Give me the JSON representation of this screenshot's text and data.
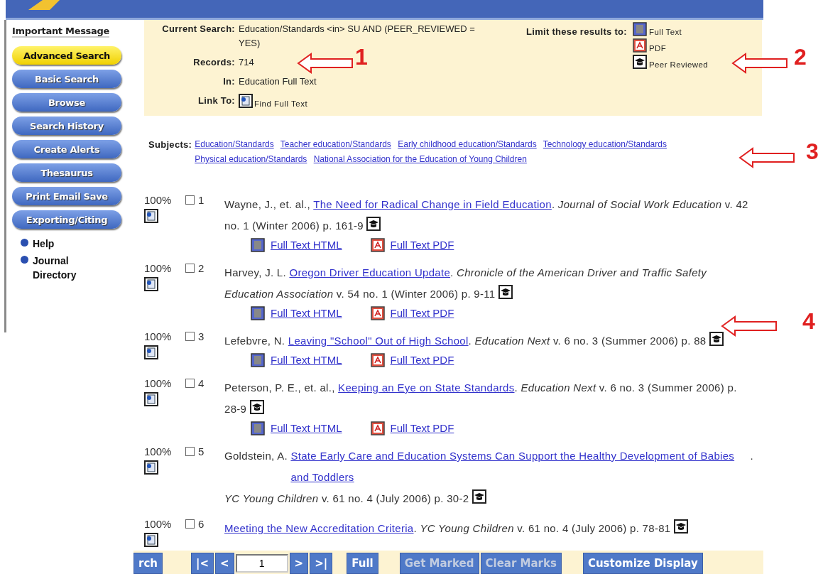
{
  "sidebar": {
    "message": "Important Message",
    "buttons": [
      {
        "label": "Advanced Search",
        "selected": true
      },
      {
        "label": "Basic Search",
        "selected": false
      },
      {
        "label": "Browse",
        "selected": false
      },
      {
        "label": "Search History",
        "selected": false
      },
      {
        "label": "Create Alerts",
        "selected": false
      },
      {
        "label": "Thesaurus",
        "selected": false
      },
      {
        "label": "Print Email Save",
        "selected": false
      },
      {
        "label": "Exporting/Citing",
        "selected": false
      }
    ],
    "links": [
      "Help",
      "Journal Directory"
    ]
  },
  "search_summary": {
    "fields": [
      {
        "kind": "text",
        "label": "Current Search:",
        "value": "Education/Standards <in> SU AND (PEER_REVIEWED = YES)"
      },
      {
        "kind": "text",
        "label": "Records:",
        "value": "714"
      },
      {
        "kind": "text",
        "label": "In:",
        "value": "Education Full Text"
      },
      {
        "kind": "link",
        "label": "Link To:",
        "value": "Find Full Text"
      }
    ],
    "limit": {
      "label": "Limit these results to:",
      "options": [
        {
          "kind": "fulltext",
          "label": "Full Text"
        },
        {
          "kind": "pdf",
          "label": "PDF"
        },
        {
          "kind": "peer",
          "label": "Peer Reviewed"
        }
      ]
    }
  },
  "subjects": {
    "label": "Subjects:",
    "items": [
      "Education/Standards",
      "Teacher education/Standards",
      "Early childhood education/Standards",
      "Technology education/Standards",
      "Physical education/Standards",
      "National Association for the Education of Young Children"
    ]
  },
  "results": [
    {
      "score": "100%",
      "checked": false,
      "number": "1",
      "lead": "Wayne, J., et. al.,",
      "title": "The Need for Radical Change in Field Education",
      "rest": ". *Journal of Social Work Education* v. 42 no. 1 (Winter 2006) p. 161-9",
      "peer_reviewed": true,
      "links": [
        {
          "kind": "html",
          "label": "Full Text HTML"
        },
        {
          "kind": "pdf",
          "label": "Full Text PDF"
        }
      ]
    },
    {
      "score": "100%",
      "checked": false,
      "number": "2",
      "lead": "Harvey, J. L.",
      "title": "Oregon Driver Education Update",
      "rest": ". *Chronicle of the American Driver and Traffic Safety Education Association* v. 54 no. 1 (Winter 2006) p. 9-11",
      "peer_reviewed": true,
      "links": [
        {
          "kind": "html",
          "label": "Full Text HTML"
        },
        {
          "kind": "pdf",
          "label": "Full Text PDF"
        }
      ]
    },
    {
      "score": "100%",
      "checked": false,
      "number": "3",
      "lead": "Lefebvre, N.",
      "title": "Leaving \"School\" Out of High School",
      "rest": ". *Education Next* v. 6 no. 3 (Summer 2006) p. 88",
      "peer_reviewed": true,
      "links": [
        {
          "kind": "html",
          "label": "Full Text HTML"
        },
        {
          "kind": "pdf",
          "label": "Full Text PDF"
        }
      ]
    },
    {
      "score": "100%",
      "checked": false,
      "number": "4",
      "lead": "Peterson, P. E., et. al.,",
      "title": "Keeping an Eye on State Standards",
      "rest": ". *Education Next* v. 6 no. 3 (Summer 2006) p. 28-9",
      "peer_reviewed": true,
      "links": [
        {
          "kind": "html",
          "label": "Full Text HTML"
        },
        {
          "kind": "pdf",
          "label": "Full Text PDF"
        }
      ]
    },
    {
      "score": "100%",
      "checked": false,
      "number": "5",
      "lead": "Goldstein, A.",
      "title": "State Early Care and Education Systems Can Support the Healthy Development of Babies and Toddlers",
      "rest": ". *YC Young Children* v. 61 no. 4 (July 2006) p. 30-2",
      "peer_reviewed": true
    },
    {
      "score": "100%",
      "checked": false,
      "number": "6",
      "title": "Meeting the New Accreditation Criteria",
      "rest": ". *YC Young Children* v. 61 no. 4 (July 2006) p. 78-81",
      "peer_reviewed": true
    }
  ],
  "toolbar": [
    {
      "kind": "button",
      "label": "rch",
      "disabled": false
    },
    {
      "kind": "button",
      "label": "|<",
      "disabled": false
    },
    {
      "kind": "button",
      "label": "<",
      "disabled": false
    },
    {
      "kind": "input",
      "value": "1",
      "disabled": false
    },
    {
      "kind": "button",
      "label": ">",
      "disabled": false
    },
    {
      "kind": "button",
      "label": ">|",
      "disabled": false
    },
    {
      "kind": "button",
      "label": "Full",
      "disabled": false
    },
    {
      "kind": "button",
      "label": "Get Marked",
      "disabled": true
    },
    {
      "kind": "button",
      "label": "Clear Marks",
      "disabled": true
    },
    {
      "kind": "button",
      "label": "Customize Display",
      "disabled": false
    }
  ],
  "annotations": [
    {
      "number": "1"
    },
    {
      "number": "2"
    },
    {
      "number": "3"
    },
    {
      "number": "4"
    }
  ]
}
